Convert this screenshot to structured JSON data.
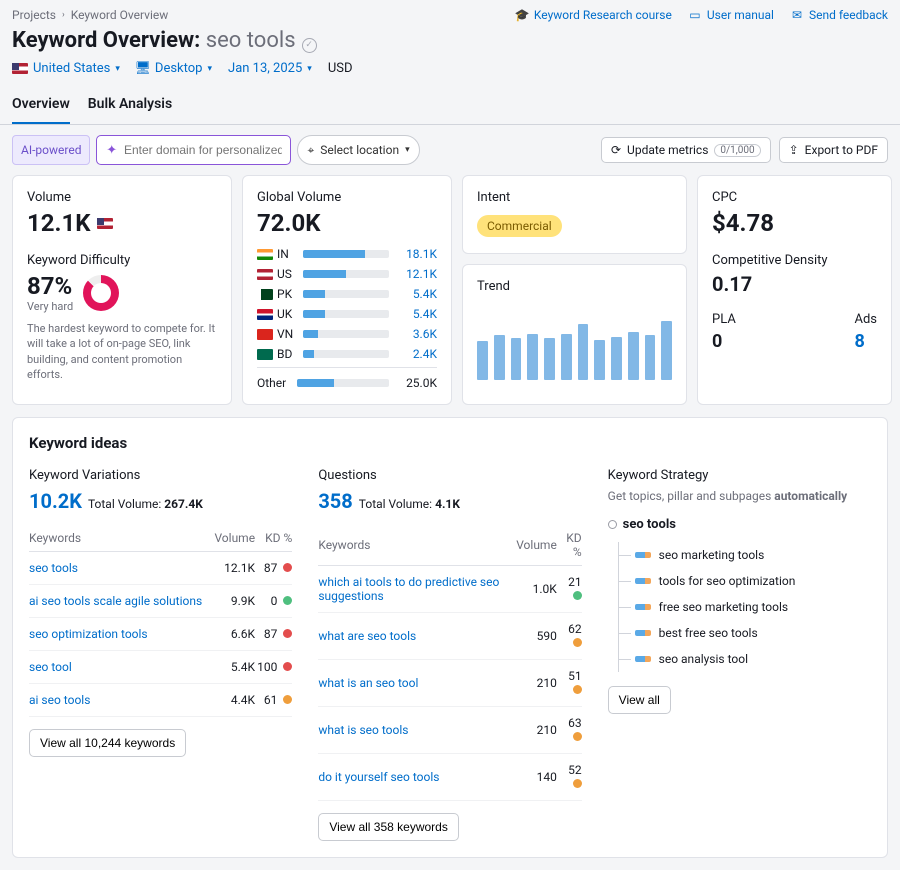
{
  "breadcrumb": {
    "root": "Projects",
    "current": "Keyword Overview"
  },
  "quicklinks": {
    "course": "Keyword Research course",
    "manual": "User manual",
    "feedback": "Send feedback"
  },
  "header": {
    "title_prefix": "Keyword Overview:",
    "keyword": "seo tools"
  },
  "filters": {
    "country": "United States",
    "device": "Desktop",
    "date": "Jan 13, 2025",
    "currency": "USD"
  },
  "tabs": {
    "overview": "Overview",
    "bulk": "Bulk Analysis"
  },
  "toolbar": {
    "ai": "AI-powered",
    "domain_placeholder": "Enter domain for personalized data",
    "location": "Select location",
    "update": "Update metrics",
    "counter": "0/1,000",
    "export": "Export to PDF"
  },
  "volume": {
    "label": "Volume",
    "value": "12.1K"
  },
  "kd": {
    "label": "Keyword Difficulty",
    "value": "87%",
    "level": "Very hard",
    "desc": "The hardest keyword to compete for. It will take a lot of on-page SEO, link building, and content promotion efforts."
  },
  "global": {
    "label": "Global Volume",
    "value": "72.0K",
    "rows": [
      {
        "cc": "IN",
        "val": "18.1K",
        "pct": 72
      },
      {
        "cc": "US",
        "val": "12.1K",
        "pct": 50
      },
      {
        "cc": "PK",
        "val": "5.4K",
        "pct": 26
      },
      {
        "cc": "UK",
        "val": "5.4K",
        "pct": 26
      },
      {
        "cc": "VN",
        "val": "3.6K",
        "pct": 18
      },
      {
        "cc": "BD",
        "val": "2.4K",
        "pct": 13
      }
    ],
    "other_label": "Other",
    "other_val": "25.0K",
    "other_pct": 40
  },
  "intent": {
    "label": "Intent",
    "value": "Commercial"
  },
  "trend": {
    "label": "Trend"
  },
  "cpc": {
    "label": "CPC",
    "value": "$4.78"
  },
  "cd": {
    "label": "Competitive Density",
    "value": "0.17"
  },
  "pla": {
    "label": "PLA",
    "value": "0"
  },
  "ads": {
    "label": "Ads",
    "value": "8"
  },
  "ideas": {
    "title": "Keyword ideas",
    "variations": {
      "title": "Keyword Variations",
      "count": "10.2K",
      "tv_label": "Total Volume:",
      "tv": "267.4K",
      "cols": {
        "kw": "Keywords",
        "vol": "Volume",
        "kd": "KD %"
      },
      "rows": [
        {
          "kw": "seo tools",
          "vol": "12.1K",
          "kd": "87",
          "dot": "red"
        },
        {
          "kw": "ai seo tools scale agile solutions",
          "vol": "9.9K",
          "kd": "0",
          "dot": "green"
        },
        {
          "kw": "seo optimization tools",
          "vol": "6.6K",
          "kd": "87",
          "dot": "red"
        },
        {
          "kw": "seo tool",
          "vol": "5.4K",
          "kd": "100",
          "dot": "red"
        },
        {
          "kw": "ai seo tools",
          "vol": "4.4K",
          "kd": "61",
          "dot": "orange"
        }
      ],
      "viewall": "View all 10,244 keywords"
    },
    "questions": {
      "title": "Questions",
      "count": "358",
      "tv_label": "Total Volume:",
      "tv": "4.1K",
      "cols": {
        "kw": "Keywords",
        "vol": "Volume",
        "kd": "KD %"
      },
      "rows": [
        {
          "kw": "which ai tools to do predictive seo suggestions",
          "vol": "1.0K",
          "kd": "21",
          "dot": "green"
        },
        {
          "kw": "what are seo tools",
          "vol": "590",
          "kd": "62",
          "dot": "orange"
        },
        {
          "kw": "what is an seo tool",
          "vol": "210",
          "kd": "51",
          "dot": "orange"
        },
        {
          "kw": "what is seo tools",
          "vol": "210",
          "kd": "63",
          "dot": "orange"
        },
        {
          "kw": "do it yourself seo tools",
          "vol": "140",
          "kd": "52",
          "dot": "orange"
        }
      ],
      "viewall": "View all 358 keywords"
    },
    "strategy": {
      "title": "Keyword Strategy",
      "desc_pre": "Get topics, pillar and subpages ",
      "desc_bold": "automatically",
      "root": "seo tools",
      "items": [
        "seo marketing tools",
        "tools for seo optimization",
        "free seo marketing tools",
        "best free seo tools",
        "seo analysis tool"
      ],
      "viewall": "View all"
    }
  },
  "chart_data": {
    "type": "bar",
    "title": "Trend",
    "values": [
      54,
      62,
      58,
      64,
      58,
      64,
      78,
      56,
      60,
      66,
      62,
      82
    ],
    "ylim": [
      0,
      100
    ]
  },
  "flags": {
    "IN": "linear-gradient(#ff9933 33%,#fff 33% 66%,#138808 66%)",
    "US": "linear-gradient(#b22234 33%,#fff 33% 66%,#b22234 66%)",
    "PK": "linear-gradient(90deg,#fff 25%,#01411c 25%)",
    "UK": "linear-gradient(#cf142b 40%,#fff 40% 60%,#00247d 60%)",
    "VN": "#da251d",
    "BD": "#006a4e"
  }
}
